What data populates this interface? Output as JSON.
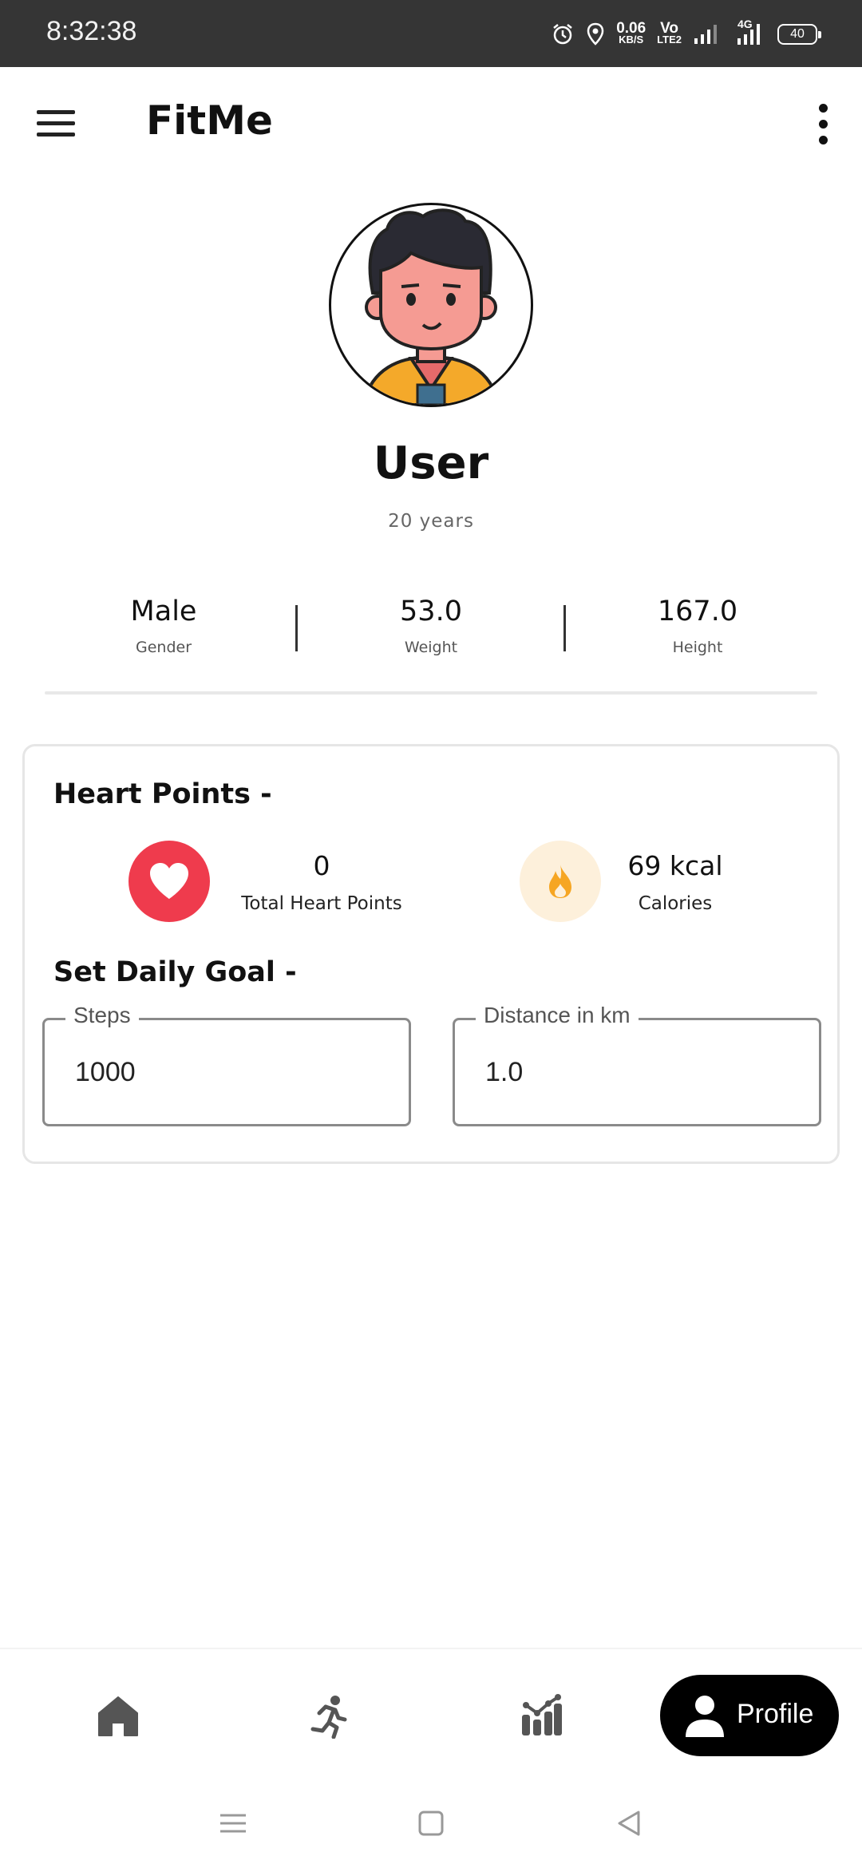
{
  "status_bar": {
    "time": "8:32:38",
    "net_speed_value": "0.06",
    "net_speed_unit": "KB/S",
    "volte_top": "Vo",
    "volte_bottom": "LTE2",
    "network_type": "4G",
    "battery": "40"
  },
  "app_bar": {
    "title": "FitMe",
    "menu_icon": "hamburger-menu-icon",
    "more_icon": "more-vertical-icon"
  },
  "profile": {
    "avatar_icon": "user-avatar",
    "name": "User",
    "age": "20 years",
    "stats": [
      {
        "value": "Male",
        "label": "Gender"
      },
      {
        "value": "53.0",
        "label": "Weight"
      },
      {
        "value": "167.0",
        "label": "Height"
      }
    ]
  },
  "card": {
    "heart_section_title": "Heart Points -",
    "heart_points_value": "0",
    "heart_points_label": "Total Heart Points",
    "calories_value": "69 kcal",
    "calories_label": "Calories",
    "goal_section_title": "Set Daily Goal -",
    "steps_label": "Steps",
    "steps_value": "1000",
    "distance_label": "Distance in km",
    "distance_value": "1.0"
  },
  "bottom_nav": {
    "items": [
      {
        "icon": "home-icon"
      },
      {
        "icon": "running-icon"
      },
      {
        "icon": "stats-chart-icon"
      },
      {
        "icon": "person-icon",
        "label": "Profile",
        "active": true
      }
    ]
  },
  "colors": {
    "accent_heart": "#ef3b4d",
    "calorie_bg": "#fdf0db",
    "calorie_flame": "#f6a623",
    "nav_active_bg": "#000000"
  }
}
